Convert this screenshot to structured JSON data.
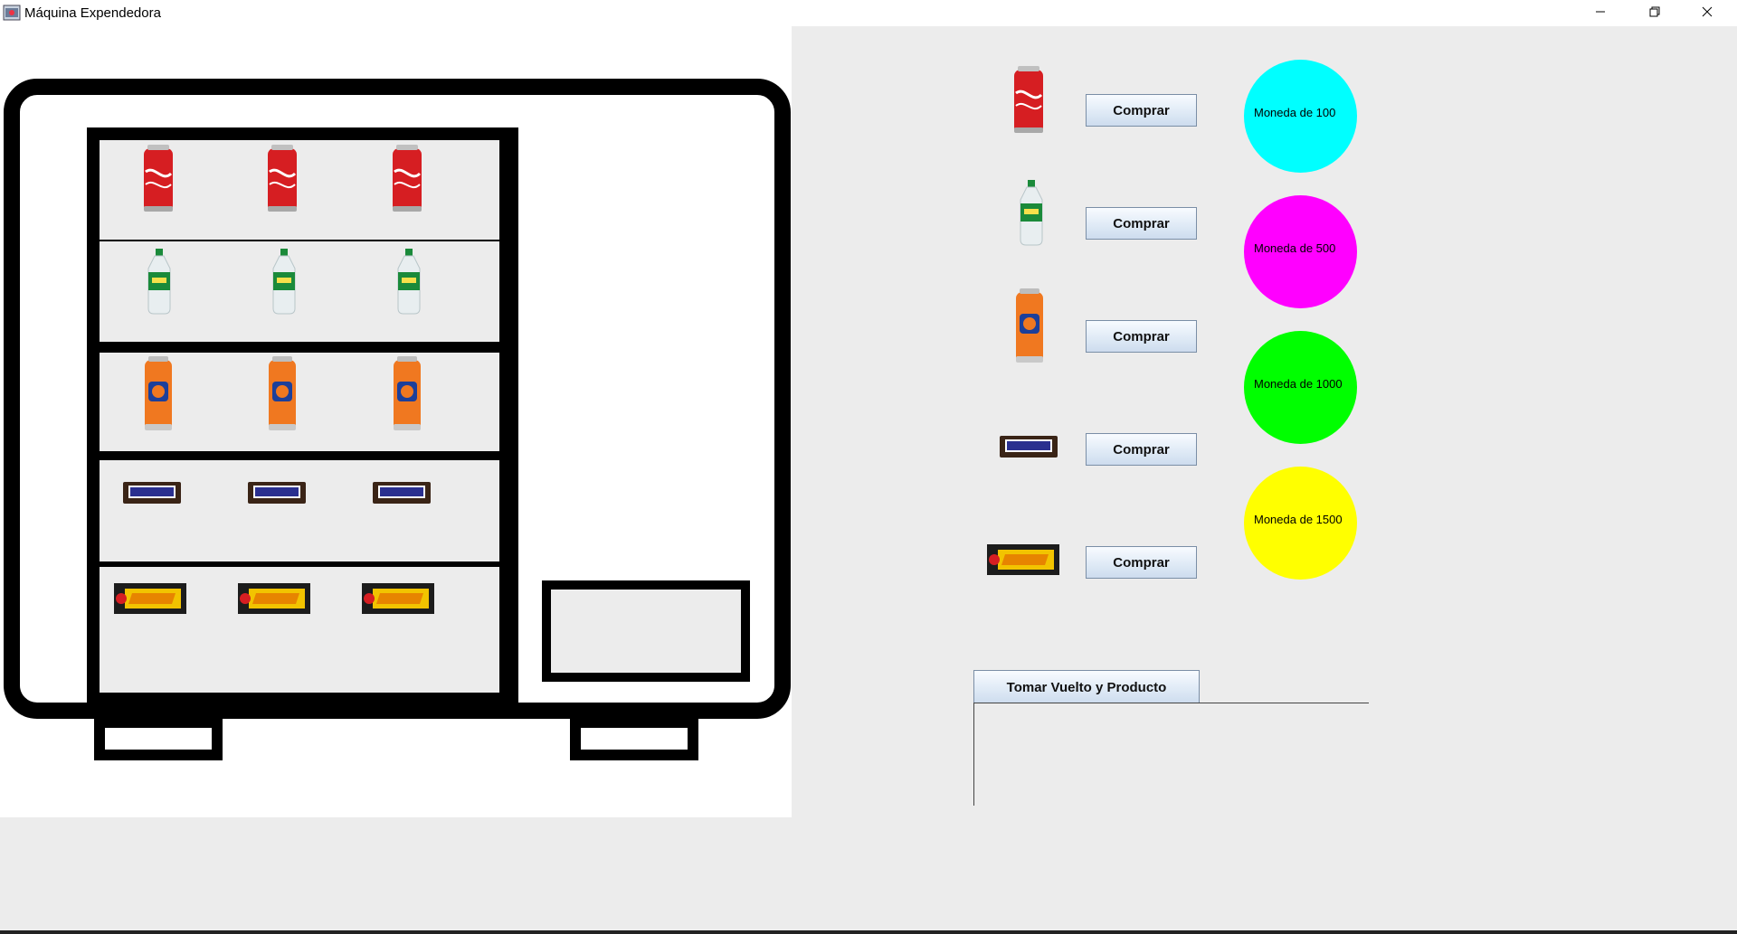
{
  "window": {
    "title": "Máquina Expendedora",
    "controls": [
      "minimize-icon",
      "maximize-icon",
      "close-icon"
    ]
  },
  "machine": {
    "shelves": [
      {
        "product": "Coca-Cola",
        "count": 3
      },
      {
        "product": "Sprite",
        "count": 3
      },
      {
        "product": "Fanta",
        "count": 3
      },
      {
        "product": "Snickers",
        "count": 3
      },
      {
        "product": "Super8",
        "count": 3
      }
    ]
  },
  "products": [
    {
      "name": "Coca-Cola",
      "button_label": "Comprar"
    },
    {
      "name": "Sprite",
      "button_label": "Comprar"
    },
    {
      "name": "Fanta",
      "button_label": "Comprar"
    },
    {
      "name": "Snickers",
      "button_label": "Comprar"
    },
    {
      "name": "Super8",
      "button_label": "Comprar"
    }
  ],
  "coins": [
    {
      "label": "Moneda de 100",
      "color": "#00ffff"
    },
    {
      "label": "Moneda de 500",
      "color": "#ff00ff"
    },
    {
      "label": "Moneda de 1000",
      "color": "#00ff00"
    },
    {
      "label": "Moneda de 1500",
      "color": "#ffff00"
    }
  ],
  "take": {
    "label": "Tomar Vuelto y Producto"
  },
  "colors": {
    "coke": "#d61e22",
    "sprite_label": "#1a8a3a",
    "fanta": "#f07820",
    "snickers": "#3a2416",
    "super8": "#f2c300"
  }
}
